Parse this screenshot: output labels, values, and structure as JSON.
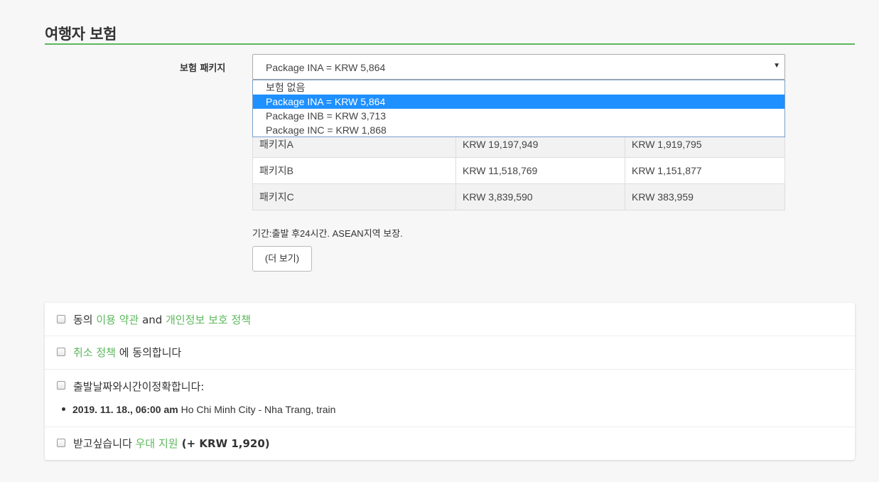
{
  "section": {
    "title": "여행자 보험",
    "accent_color": "#5cb85c"
  },
  "insurance": {
    "label": "보험 패키지",
    "selected_value": "Package INA = KRW 5,864",
    "options": [
      "보험 없음",
      "Package INA = KRW 5,864",
      "Package INB = KRW 3,713",
      "Package INC = KRW 1,868"
    ],
    "selected_index": 1,
    "table": [
      [
        "패키지A",
        "KRW 19,197,949",
        "KRW 1,919,795"
      ],
      [
        "패키지B",
        "KRW 11,518,769",
        "KRW 1,151,877"
      ],
      [
        "패키지C",
        "KRW 3,839,590",
        "KRW 383,959"
      ]
    ],
    "description": "기간:출발 후24시간. ASEAN지역 보장.",
    "more_button": "(더 보기)"
  },
  "agreements": {
    "terms": {
      "prefix": "동의 ",
      "terms_link": "이용 약관",
      "and": " and ",
      "privacy_link": "개인정보 보호 정책"
    },
    "cancel": {
      "cancel_link": "취소 정책",
      "suffix": " 에 동의합니다"
    },
    "datetime": {
      "text": "출발날짜와시간이정확합니다:",
      "trip_datetime": "2019. 11. 18., 06:00 am",
      "trip_route": " Ho Chi Minh City - Nha Trang, train"
    },
    "promo": {
      "prefix": "받고싶습니다 ",
      "promo_link": "우대 지원",
      "price": " (+ KRW 1,920)"
    }
  }
}
